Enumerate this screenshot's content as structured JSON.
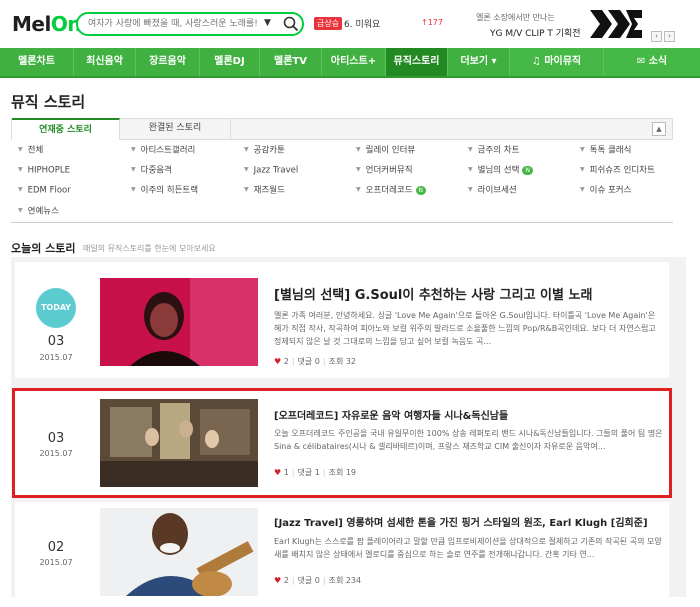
{
  "header": {
    "logo_main": "Mel",
    "logo_accent": "On",
    "search_placeholder": "여자가 사랑에 빠졌을 때, 사랑스러운 노래를!",
    "search_arrow": "▼",
    "chart_badge": "급상승",
    "chart_rank": "6. 미워요",
    "chart_change": "↑177",
    "promo_line1": "멜론 소장에서만 만나는",
    "promo_line2": "YG M/V CLIP T 기획전",
    "pager_prev": "‹",
    "pager_next": "›"
  },
  "nav": [
    {
      "label": "멜론차트"
    },
    {
      "label": "최신음악"
    },
    {
      "label": "장르음악"
    },
    {
      "label": "멜론DJ"
    },
    {
      "label": "멜론TV"
    },
    {
      "label": "아티스트+"
    },
    {
      "label": "뮤직스토리"
    },
    {
      "label": "더보기 ▾"
    },
    {
      "label": "마이뮤직"
    },
    {
      "label": "소식"
    }
  ],
  "page_title": "뮤직 스토리",
  "tabs": [
    {
      "label": "연재중 스토리"
    },
    {
      "label": "완결된 스토리"
    }
  ],
  "tab_scroll_up": "▲",
  "categories": [
    {
      "label": "전체"
    },
    {
      "label": "아티스트갤러리"
    },
    {
      "label": "공감카툰"
    },
    {
      "label": "릴레이 인터뷰"
    },
    {
      "label": "금주의 차트"
    },
    {
      "label": "톡톡 클래식"
    },
    {
      "label": "HIPHOPLE"
    },
    {
      "label": "다중음격"
    },
    {
      "label": "Jazz Travel"
    },
    {
      "label": "언더커버뮤직"
    },
    {
      "label": "별님의 선택"
    },
    {
      "label": "피쉬슈즈 인디차트"
    },
    {
      "label": "EDM Floor"
    },
    {
      "label": "이주의 히든트랙"
    },
    {
      "label": "재즈월드"
    },
    {
      "label": "오프더레코드"
    },
    {
      "label": "라이브세션"
    },
    {
      "label": "이슈 포커스"
    },
    {
      "label": "연예뉴스"
    }
  ],
  "new_badge": "N",
  "today": {
    "title": "오늘의 스토리",
    "desc": "매일의 뮤직스토리를 한눈에 모아보세요"
  },
  "today_badge": "TODAY",
  "stories": [
    {
      "day": "03",
      "ym": "2015.07",
      "title": "[별님의 선택] G.Soul이 추천하는 사랑 그리고 이별 노래",
      "body": "멜론 가족 여러분, 안녕하세요. 싱글 'Love Me Again'으로 돌아온 G.Soul입니다. 타이틀곡 'Love Me Again'은 혜가 직접 작사, 작곡하여 피아노와 보컬 위주의 발라드로 소울풀한 느낌의 Pop/R&B곡인데요. 보다 더 자연스럽고 정제되지 않은 날 것 그대로의 느낌을 담고 싶어 보컬 녹음도 곡...",
      "likes": "2",
      "comments": "댓글 0",
      "views": "조회 32"
    },
    {
      "day": "03",
      "ym": "2015.07",
      "title": "[오프더레코드] 자유로운 음악 여행자들 시나&독신남들",
      "body": "오늘 오프더레코드 주인공을 국내 유일무이한 100% 상송 레퍼토리 밴드 시나&독신남들입니다. 그들의 풀어 팀 명은 Sina & célibataires(시나 & 셀리바테르)이며, 프랑스 재즈학교 CIM 출신이자 자유로운 음악여...",
      "likes": "1",
      "comments": "댓글 1",
      "views": "조회 19"
    },
    {
      "day": "02",
      "ym": "2015.07",
      "title": "[Jazz Travel] 영롱하며 섬세한 톤을 가진 핑거 스타일의 원조, Earl Klugh [김희준]",
      "body": "Earl Klugh는 스스로를 팝 플레이어라고 말할 만큼 임프로비제이션을 상대적으로 절제하고 기존의 작곡된 곡의 모양새를 배치지 않은 상태에서 멜로디를 중심으로 하는 솔로 연주를 전개해나갑니다. 간혹 기타 연...",
      "likes": "2",
      "comments": "댓글 0",
      "views": "조회 234"
    }
  ],
  "colors": {
    "brand_green": "#40b040",
    "nav_active": "#238a23",
    "highlight_red": "#e02020",
    "today_badge": "#5bcbd0"
  }
}
